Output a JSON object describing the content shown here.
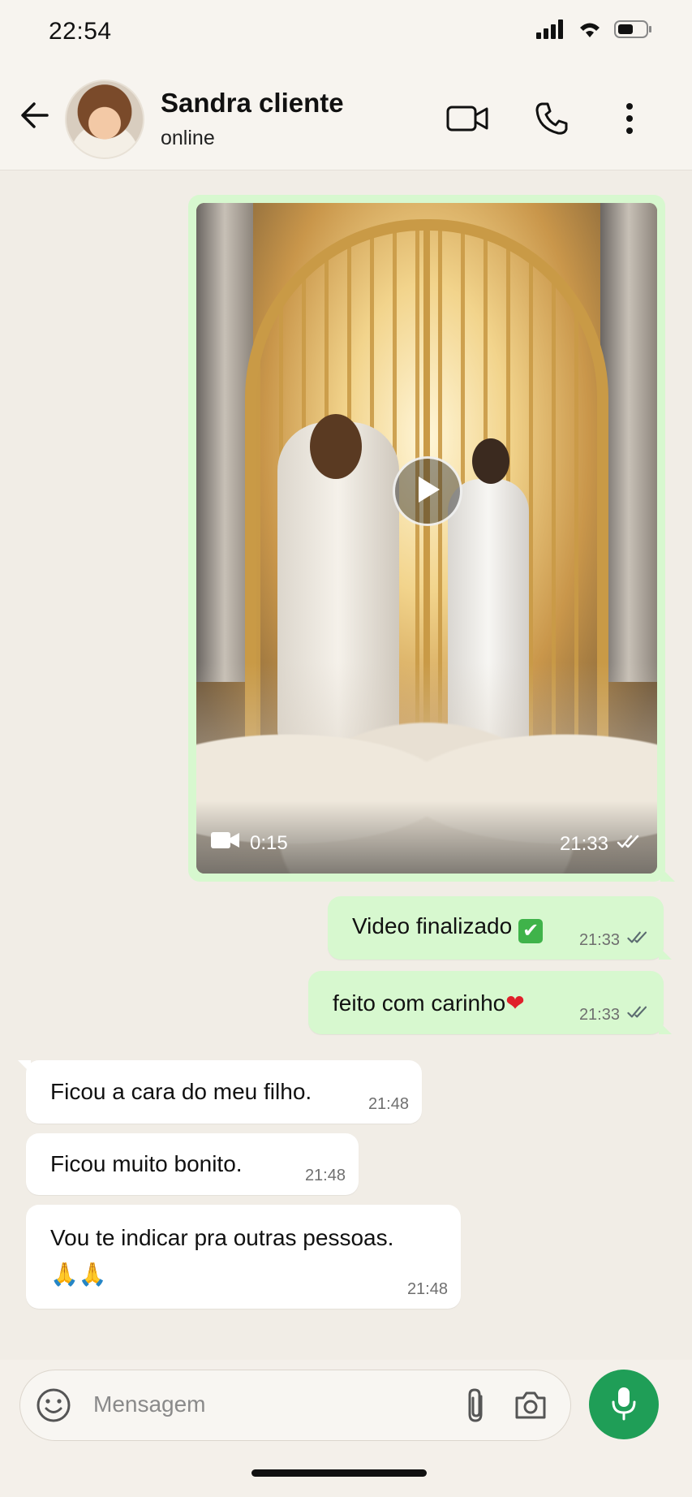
{
  "status_bar": {
    "time": "22:54"
  },
  "header": {
    "contact_name": "Sandra cliente",
    "contact_status": "online"
  },
  "video_message": {
    "duration": "0:15",
    "time": "21:33"
  },
  "messages": [
    {
      "direction": "out",
      "text": "Video finalizado",
      "emoji": "✔",
      "time": "21:33"
    },
    {
      "direction": "out",
      "text": "feito  com carinho",
      "emoji": "❤",
      "time": "21:33"
    },
    {
      "direction": "in",
      "text": "Ficou a cara do meu filho.",
      "time": "21:48"
    },
    {
      "direction": "in",
      "text": "Ficou muito bonito.",
      "time": "21:48"
    },
    {
      "direction": "in",
      "text": "Vou te indicar pra outras pessoas.",
      "emoji": "🙏🙏",
      "time": "21:48"
    }
  ],
  "composer": {
    "placeholder": "Mensagem"
  },
  "colors": {
    "outgoing_bubble": "#d7f8cf",
    "incoming_bubble": "#ffffff",
    "mic_button": "#1f9e57",
    "chat_bg": "#f1ede6"
  }
}
